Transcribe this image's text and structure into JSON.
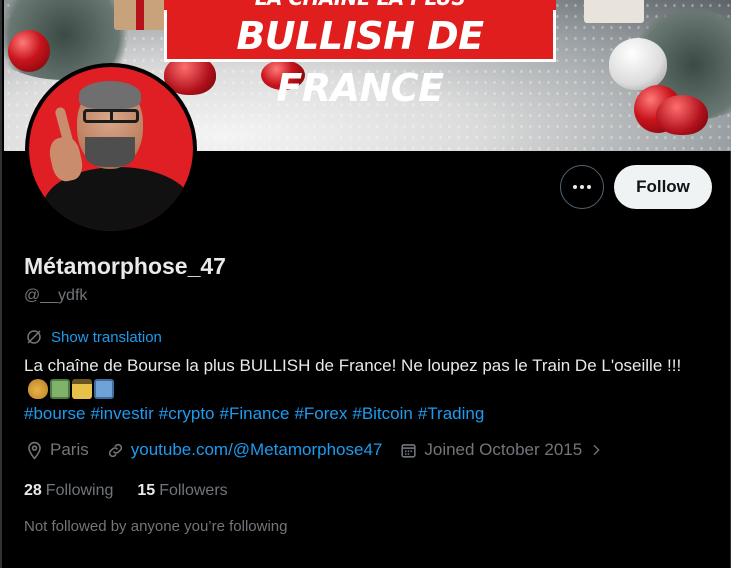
{
  "banner": {
    "top_text": "LA CHAÎNE LA PLUS",
    "main_text": "BULLISH DE FRANCE"
  },
  "profile": {
    "display_name": "Métamorphose_47",
    "handle": "@__ydfk",
    "show_translation": "Show translation",
    "bio_text": "La chaîne de Bourse la plus BULLISH de France! Ne loupez pas le Train De L'oseille !!!",
    "hashtags": [
      "#bourse",
      "#investir",
      "#crypto",
      "#Finance",
      "#Forex",
      "#Bitcoin",
      "#Trading"
    ],
    "location": "Paris",
    "website": "youtube.com/@Metamorphose47",
    "joined": "Joined October 2015",
    "following_count": "28",
    "following_label": "Following",
    "followers_count": "15",
    "followers_label": "Followers",
    "not_followed": "Not followed by anyone you’re following"
  },
  "actions": {
    "follow_label": "Follow"
  },
  "colors": {
    "accent": "#1d9bf0",
    "banner_red": "#e01e1e",
    "muted": "#71767b"
  },
  "icons": {
    "more": "more-dots-icon",
    "translate": "translate-icon",
    "location": "location-pin-icon",
    "link": "link-icon",
    "calendar": "calendar-icon",
    "chevron": "chevron-right-icon"
  }
}
